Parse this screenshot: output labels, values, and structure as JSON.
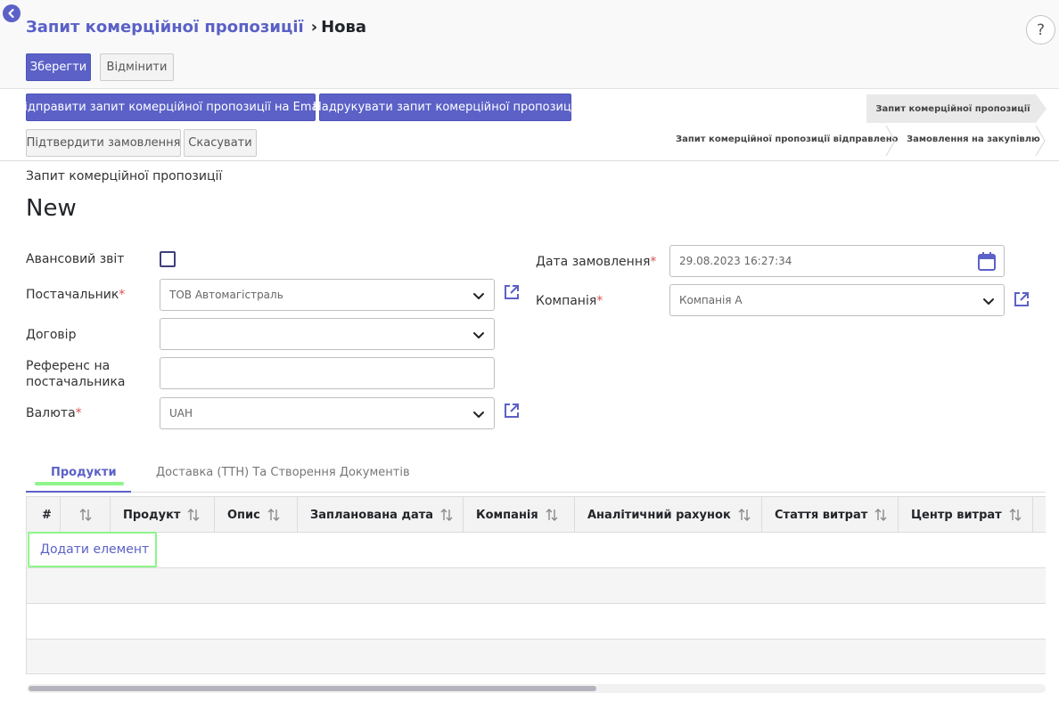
{
  "header": {
    "breadcrumb_parent": "Запит комерційної пропозиції",
    "breadcrumb_current": "Нова",
    "help_label": "?"
  },
  "toolbar": {
    "save_label": "Зберегти",
    "discard_label": "Відмінити"
  },
  "actions": {
    "send_email_label": "Відправити запит комерційної пропозиції на Email",
    "print_label": "Надрукувати запит комерційної пропозиції",
    "confirm_label": "Підтвердити замовлення",
    "cancel_label": "Скасувати"
  },
  "statusbar": {
    "stages": [
      {
        "label": "Запит комерційної пропозиції",
        "active": true
      },
      {
        "label": "Запит комерційної пропозиції відправлено",
        "active": false
      },
      {
        "label": "Замовлення на закупівлю",
        "active": false
      }
    ]
  },
  "form": {
    "doc_label": "Запит комерційної пропозиції",
    "doc_name": "New",
    "advance_report_label": "Авансовий звіт",
    "advance_report_checked": false,
    "supplier_label": "Постачальник",
    "supplier_value": "ТОВ Автомагістраль",
    "contract_label": "Договір",
    "contract_value": "",
    "supplier_ref_label": "Референс на постачальника",
    "supplier_ref_value": "",
    "currency_label": "Валюта",
    "currency_value": "UAH",
    "order_date_label": "Дата замовлення",
    "order_date_value": "29.08.2023 16:27:34",
    "company_label": "Компанія",
    "company_value": "Компанія А",
    "required_mark": "*"
  },
  "tabs": [
    {
      "label": "Продукти",
      "active": true
    },
    {
      "label": "Доставка (ТТН) Та Створення Документів",
      "active": false
    }
  ],
  "table": {
    "columns": [
      "#",
      "",
      "Продукт",
      "Опис",
      "Запланована дата",
      "Компанія",
      "Аналітичний рахунок",
      "Стаття витрат",
      "Центр витрат"
    ],
    "add_line_label": "Додати елемент"
  },
  "colors": {
    "accent": "#5b61c6",
    "highlight": "#8ef58a",
    "required": "#d9534f"
  }
}
